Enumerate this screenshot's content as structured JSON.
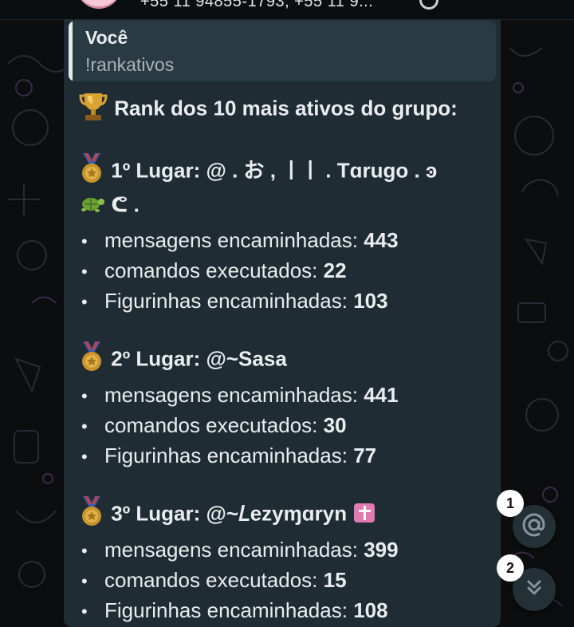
{
  "header": {
    "subtitle": "+55 11 94855-1793, +55 11 9..."
  },
  "quote": {
    "author": "Você",
    "text": "!rankativos"
  },
  "message": {
    "title": "Rank dos 10 mais ativos do grupo:",
    "places": [
      {
        "heading": "1º Lugar: @ . お , ㅣㅣ .  Tɑrugo . ͽ",
        "heading_cont": "ᕦ .",
        "stats": [
          {
            "label": "mensagens encaminhadas:",
            "value": "443"
          },
          {
            "label": "comandos executados:",
            "value": "22"
          },
          {
            "label": "Figurinhas encaminhadas:",
            "value": "103"
          }
        ]
      },
      {
        "heading": "2º Lugar: @~Sasa",
        "stats": [
          {
            "label": "mensagens encaminhadas:",
            "value": "441"
          },
          {
            "label": "comandos executados:",
            "value": "30"
          },
          {
            "label": "Figurinhas encaminhadas:",
            "value": "77"
          }
        ]
      },
      {
        "heading": "3º Lugar: @~𝐿ezyɱɑryn",
        "stats": [
          {
            "label": "mensagens encaminhadas:",
            "value": "399"
          },
          {
            "label": "comandos executados:",
            "value": "15"
          },
          {
            "label": "Figurinhas encaminhadas:",
            "value": "108"
          }
        ]
      }
    ],
    "bullet": "•"
  },
  "fabs": {
    "mention_badge": "1",
    "scroll_badge": "2"
  },
  "icons": {
    "trophy": "trophy-icon",
    "medal": "medal-icon",
    "turtle": "turtle-icon",
    "cross": "latin-cross-icon",
    "mention": "at-sign-icon",
    "scroll_down": "double-chevron-down-icon"
  },
  "colors": {
    "background": "#0b0d0e",
    "bubble": "#1f2c33",
    "quote": "#2a3a43",
    "text": "#e9edef",
    "muted": "#a9b3b8"
  }
}
